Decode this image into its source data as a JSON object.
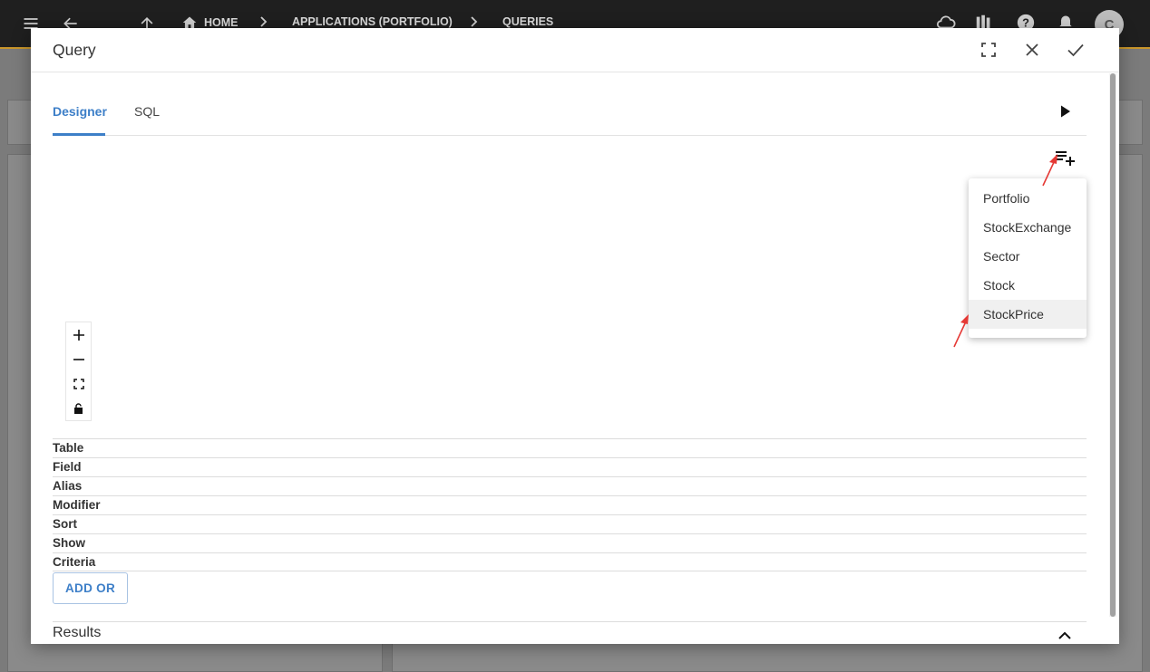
{
  "topbar": {
    "breadcrumb": [
      "HOME",
      "APPLICATIONS (PORTFOLIO)",
      "QUERIES"
    ],
    "avatar_letter": "C"
  },
  "dialog": {
    "title": "Query",
    "tabs": [
      {
        "label": "Designer",
        "active": true
      },
      {
        "label": "SQL",
        "active": false
      }
    ],
    "add_table_menu": {
      "items": [
        "Portfolio",
        "StockExchange",
        "Sector",
        "Stock",
        "StockPrice"
      ],
      "hovered_item": "StockPrice"
    },
    "zoom_controls": [
      "zoom-in",
      "zoom-out",
      "fit",
      "lock"
    ],
    "grid_rows": [
      "Table",
      "Field",
      "Alias",
      "Modifier",
      "Sort",
      "Show",
      "Criteria"
    ],
    "add_or_label": "ADD OR",
    "results_label": "Results"
  },
  "colors": {
    "accent": "#3d7fc8",
    "annotation_arrow": "#e53935",
    "topbar_bg": "#1f1f1f",
    "topbar_accent": "#c9962a"
  }
}
